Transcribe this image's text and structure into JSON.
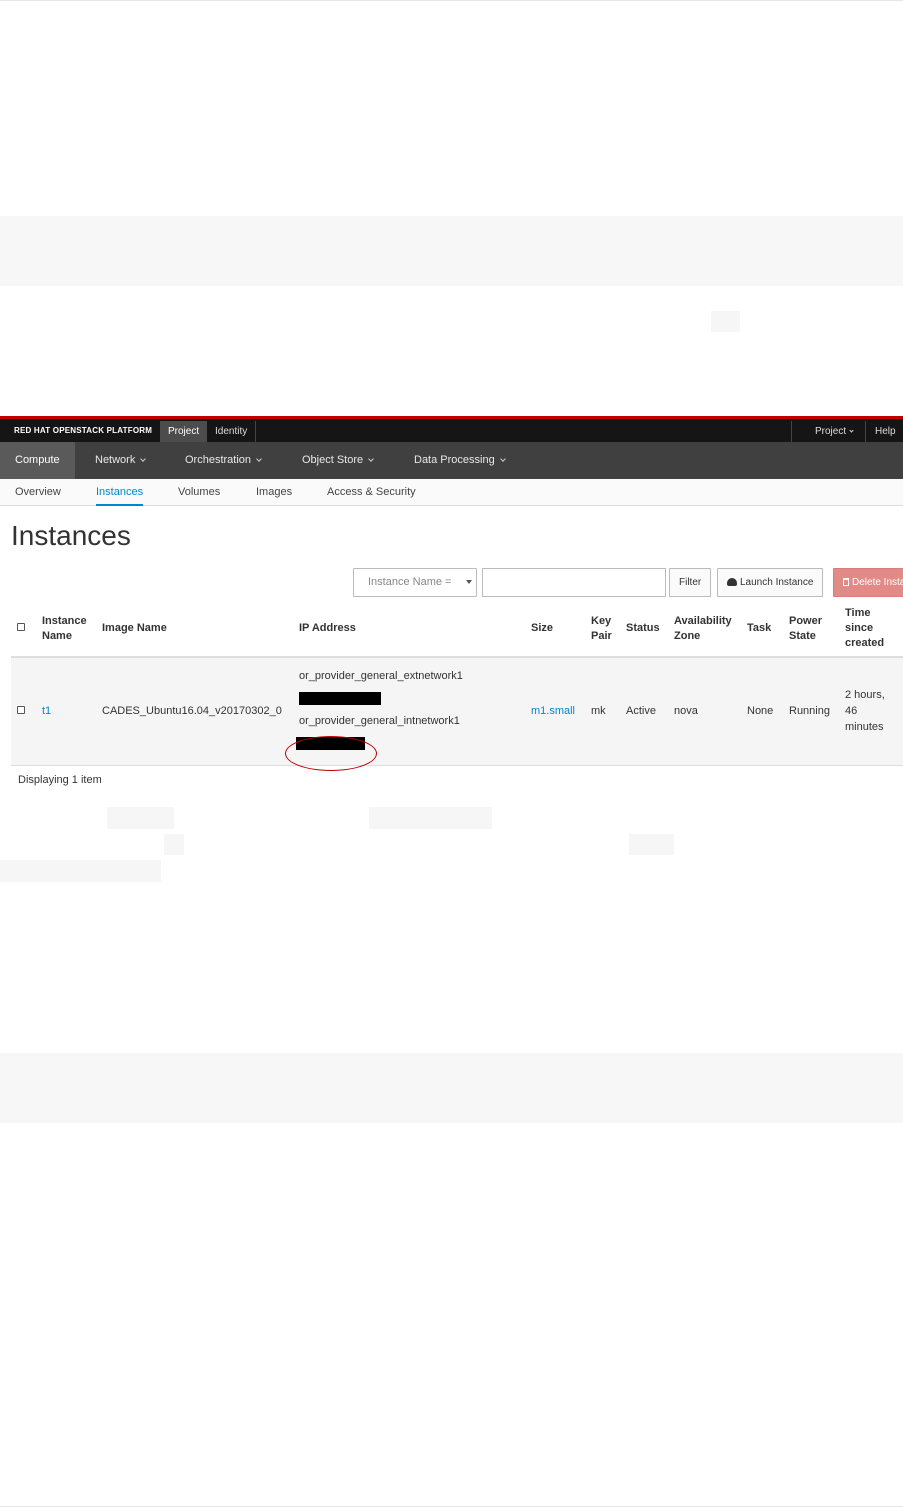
{
  "brand": "RED HAT OPENSTACK PLATFORM",
  "top_tabs": [
    "Project",
    "Identity"
  ],
  "top_right": {
    "project_menu": "Project",
    "help": "Help"
  },
  "main_nav": [
    "Compute",
    "Network",
    "Orchestration",
    "Object Store",
    "Data Processing"
  ],
  "sub_nav": [
    "Overview",
    "Instances",
    "Volumes",
    "Images",
    "Access & Security"
  ],
  "page_title": "Instances",
  "toolbar": {
    "filter_field": "Instance Name =",
    "filter_value": "",
    "filter_button": "Filter",
    "launch_button": "Launch Instance",
    "delete_button": "Delete Insta"
  },
  "table": {
    "headers": {
      "name": "Instance Name",
      "image": "Image Name",
      "ip": "IP Address",
      "size": "Size",
      "keypair": "Key Pair",
      "status": "Status",
      "az": "Availability Zone",
      "task": "Task",
      "power": "Power State",
      "age": "Time since created"
    },
    "rows": [
      {
        "name": "t1",
        "image": "CADES_Ubuntu16.04_v20170302_0",
        "net1": "or_provider_general_extnetwork1",
        "net2": "or_provider_general_intnetwork1",
        "size": "m1.small",
        "keypair": "mk",
        "status": "Active",
        "az": "nova",
        "task": "None",
        "power": "Running",
        "age": "2 hours, 46 minutes"
      }
    ]
  },
  "footer": "Displaying 1 item",
  "colors": {
    "accent": "#0088ce",
    "brand_red": "#c00000",
    "danger": "#e28a88"
  }
}
